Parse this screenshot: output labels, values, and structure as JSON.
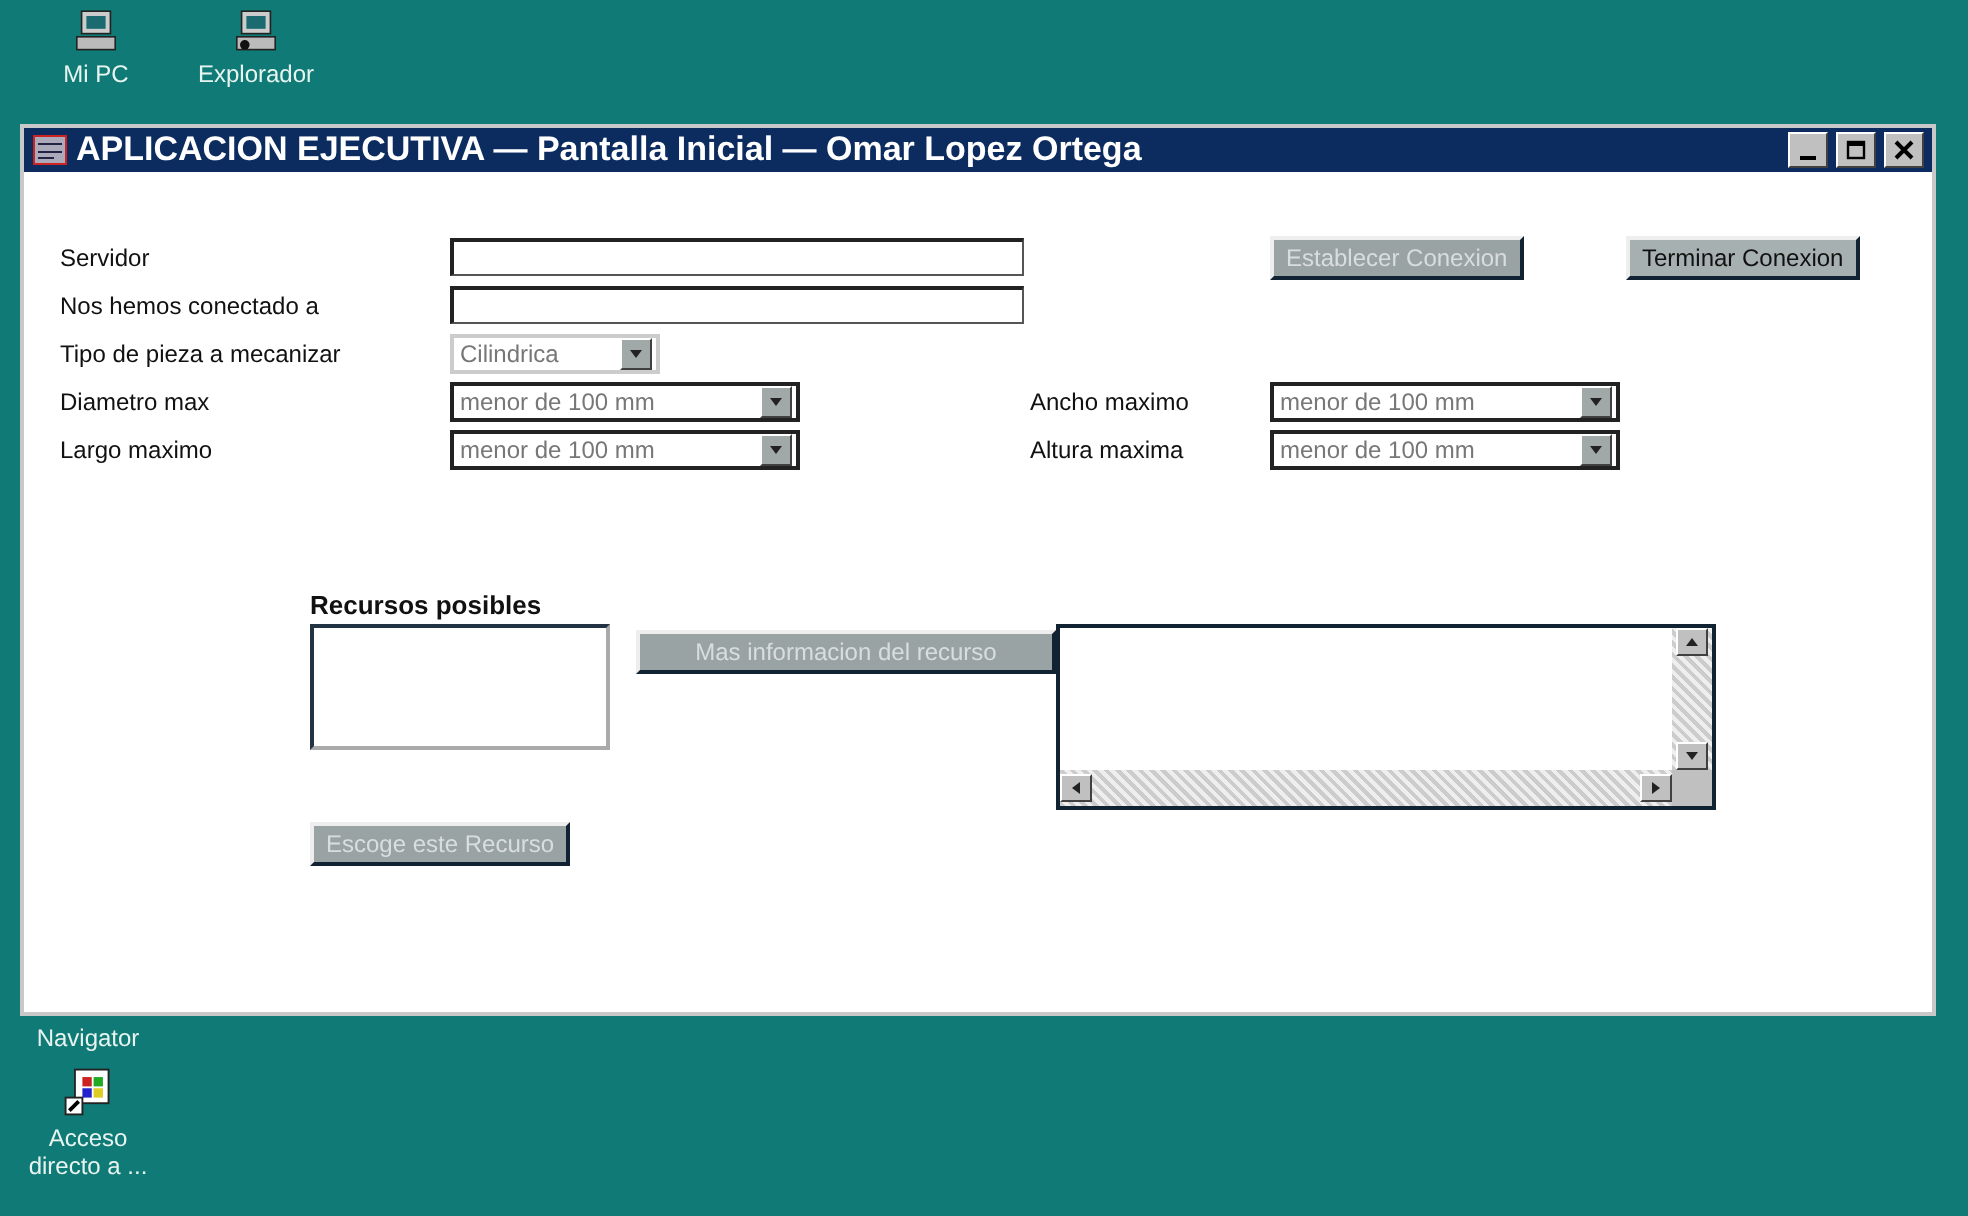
{
  "desktop_icons": [
    {
      "label": "Mi PC",
      "kind": "computer"
    },
    {
      "label": "Explorador",
      "kind": "network"
    },
    {
      "label": "Navigator",
      "kind": "covered"
    },
    {
      "label": "Acceso directo a ...",
      "kind": "shortcut"
    }
  ],
  "window": {
    "title": "APLICACION EJECUTIVA — Pantalla Inicial — Omar Lopez Ortega"
  },
  "connection_buttons": [
    {
      "label": "Establecer Conexion",
      "disabled": true
    },
    {
      "label": "Terminar Conexion",
      "disabled": false
    }
  ],
  "left_fields": [
    {
      "label": "Servidor",
      "kind": "text"
    },
    {
      "label": "Nos hemos conectado a",
      "kind": "text"
    },
    {
      "label": "Tipo de pieza a mecanizar",
      "kind": "combo",
      "value": "Cilindrica",
      "disabled": true
    },
    {
      "label": "Diametro max",
      "kind": "combo",
      "value": "menor de 100 mm",
      "disabled": false
    },
    {
      "label": "Largo maximo",
      "kind": "combo",
      "value": "menor de 100 mm",
      "disabled": false
    }
  ],
  "right_fields": [
    {
      "label": "Ancho maximo",
      "kind": "combo",
      "value": "menor de 100 mm",
      "disabled": false
    },
    {
      "label": "Altura maxima",
      "kind": "combo",
      "value": "menor de 100 mm",
      "disabled": false
    }
  ],
  "resources": {
    "label": "Recursos posibles",
    "info_button": {
      "label": "Mas informacion del recurso",
      "disabled": true
    },
    "choose_button": {
      "label": "Escoge este Recurso",
      "disabled": true
    }
  }
}
